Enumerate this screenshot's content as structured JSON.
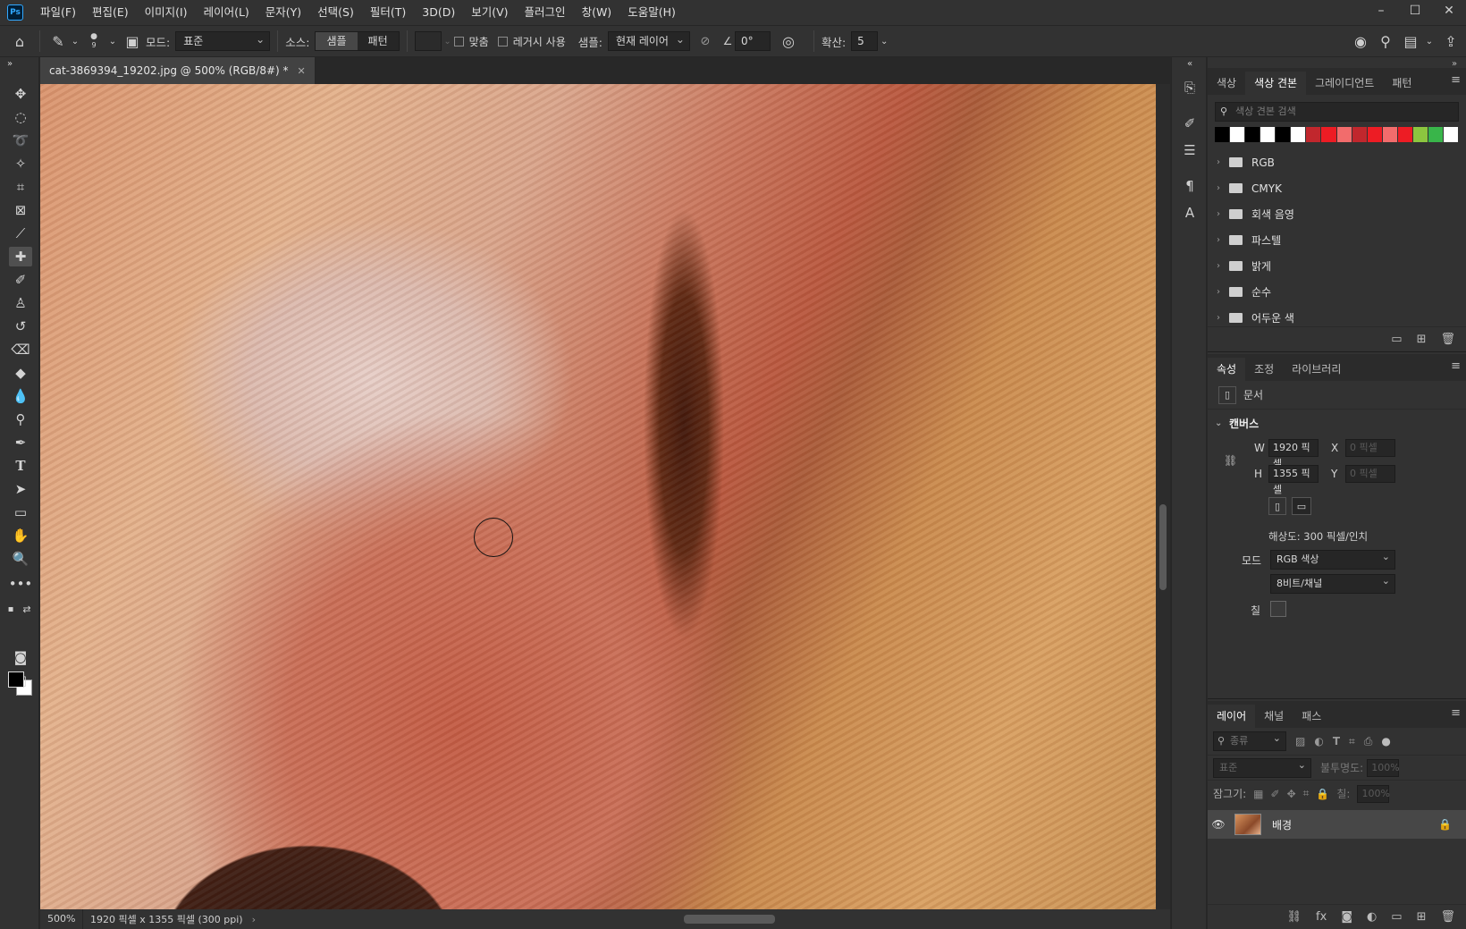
{
  "app": {
    "logo": "Ps"
  },
  "menu": [
    "파일(F)",
    "편집(E)",
    "이미지(I)",
    "레이어(L)",
    "문자(Y)",
    "선택(S)",
    "필터(T)",
    "3D(D)",
    "보기(V)",
    "플러그인",
    "창(W)",
    "도움말(H)"
  ],
  "window_controls": {
    "minimize": "–",
    "maximize": "☐",
    "close": "✕"
  },
  "options": {
    "brush_size": "9",
    "mode_label": "모드:",
    "mode_value": "표준",
    "source_label": "소스:",
    "source_sampled": "샘플",
    "source_pattern": "패턴",
    "aligned": "맞춤",
    "legacy": "레거시 사용",
    "sample_label": "샘플:",
    "sample_value": "현재 레이어",
    "angle_value": "0°",
    "diffusion_label": "확산:",
    "diffusion_value": "5"
  },
  "document": {
    "tab_title": "cat-3869394_19202.jpg @ 500% (RGB/8#) *",
    "zoom": "500%",
    "info": "1920 픽셀 x 1355 픽셀 (300 ppi)"
  },
  "swatches_panel": {
    "tabs": [
      "색상",
      "색상 견본",
      "그레이디언트",
      "패턴"
    ],
    "active_tab": 1,
    "search_placeholder": "색상 견본 검색",
    "colors": [
      "#000000",
      "#ffffff",
      "#000000",
      "#ffffff",
      "#000000",
      "#ffffff",
      "#c1272d",
      "#ed1c24",
      "#f26c6c",
      "#c1272d",
      "#ed1c24",
      "#f26c6c",
      "#ed1c24",
      "#8cc63f",
      "#39b54a",
      "#ffffff"
    ],
    "folders": [
      "RGB",
      "CMYK",
      "회색 음영",
      "파스텔",
      "밝게",
      "순수",
      "어두운 색"
    ]
  },
  "properties_panel": {
    "tabs": [
      "속성",
      "조정",
      "라이브러리"
    ],
    "document_label": "문서",
    "canvas_label": "캔버스",
    "w_label": "W",
    "w_value": "1920 픽셀",
    "h_label": "H",
    "h_value": "1355 픽셀",
    "x_label": "X",
    "x_value": "0 픽셀",
    "y_label": "Y",
    "y_value": "0 픽셀",
    "resolution": "해상도: 300 픽셀/인치",
    "mode_label": "모드",
    "mode_value": "RGB 색상",
    "bit_depth": "8비트/채널",
    "fill_label": "칠"
  },
  "layers_panel": {
    "tabs": [
      "레이어",
      "채널",
      "패스"
    ],
    "filter_placeholder": "종류",
    "blend_mode": "표준",
    "opacity_label": "불투명도:",
    "opacity_value": "100%",
    "lock_label": "잠그기:",
    "fill_label": "칠:",
    "fill_value": "100%",
    "layers": [
      {
        "name": "배경",
        "visible": true,
        "locked": true
      }
    ]
  }
}
